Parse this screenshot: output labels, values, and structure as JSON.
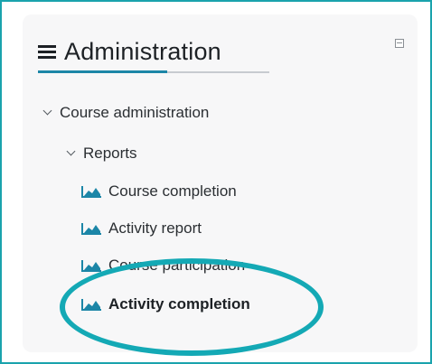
{
  "block": {
    "title": "Administration",
    "icons": {
      "menu": "hamburger-icon",
      "collapse": "collapse-block-icon"
    },
    "accent_color": "#1c86a7"
  },
  "tree": {
    "course_administration": "Course administration",
    "reports": "Reports",
    "items": [
      {
        "label": "Course completion",
        "icon": "report-chart-icon"
      },
      {
        "label": "Activity report",
        "icon": "report-chart-icon"
      },
      {
        "label": "Course participation",
        "icon": "report-chart-icon"
      },
      {
        "label": "Activity completion",
        "icon": "report-chart-icon",
        "selected": true
      }
    ]
  },
  "annotation": {
    "highlight_color": "#14a9b5"
  }
}
